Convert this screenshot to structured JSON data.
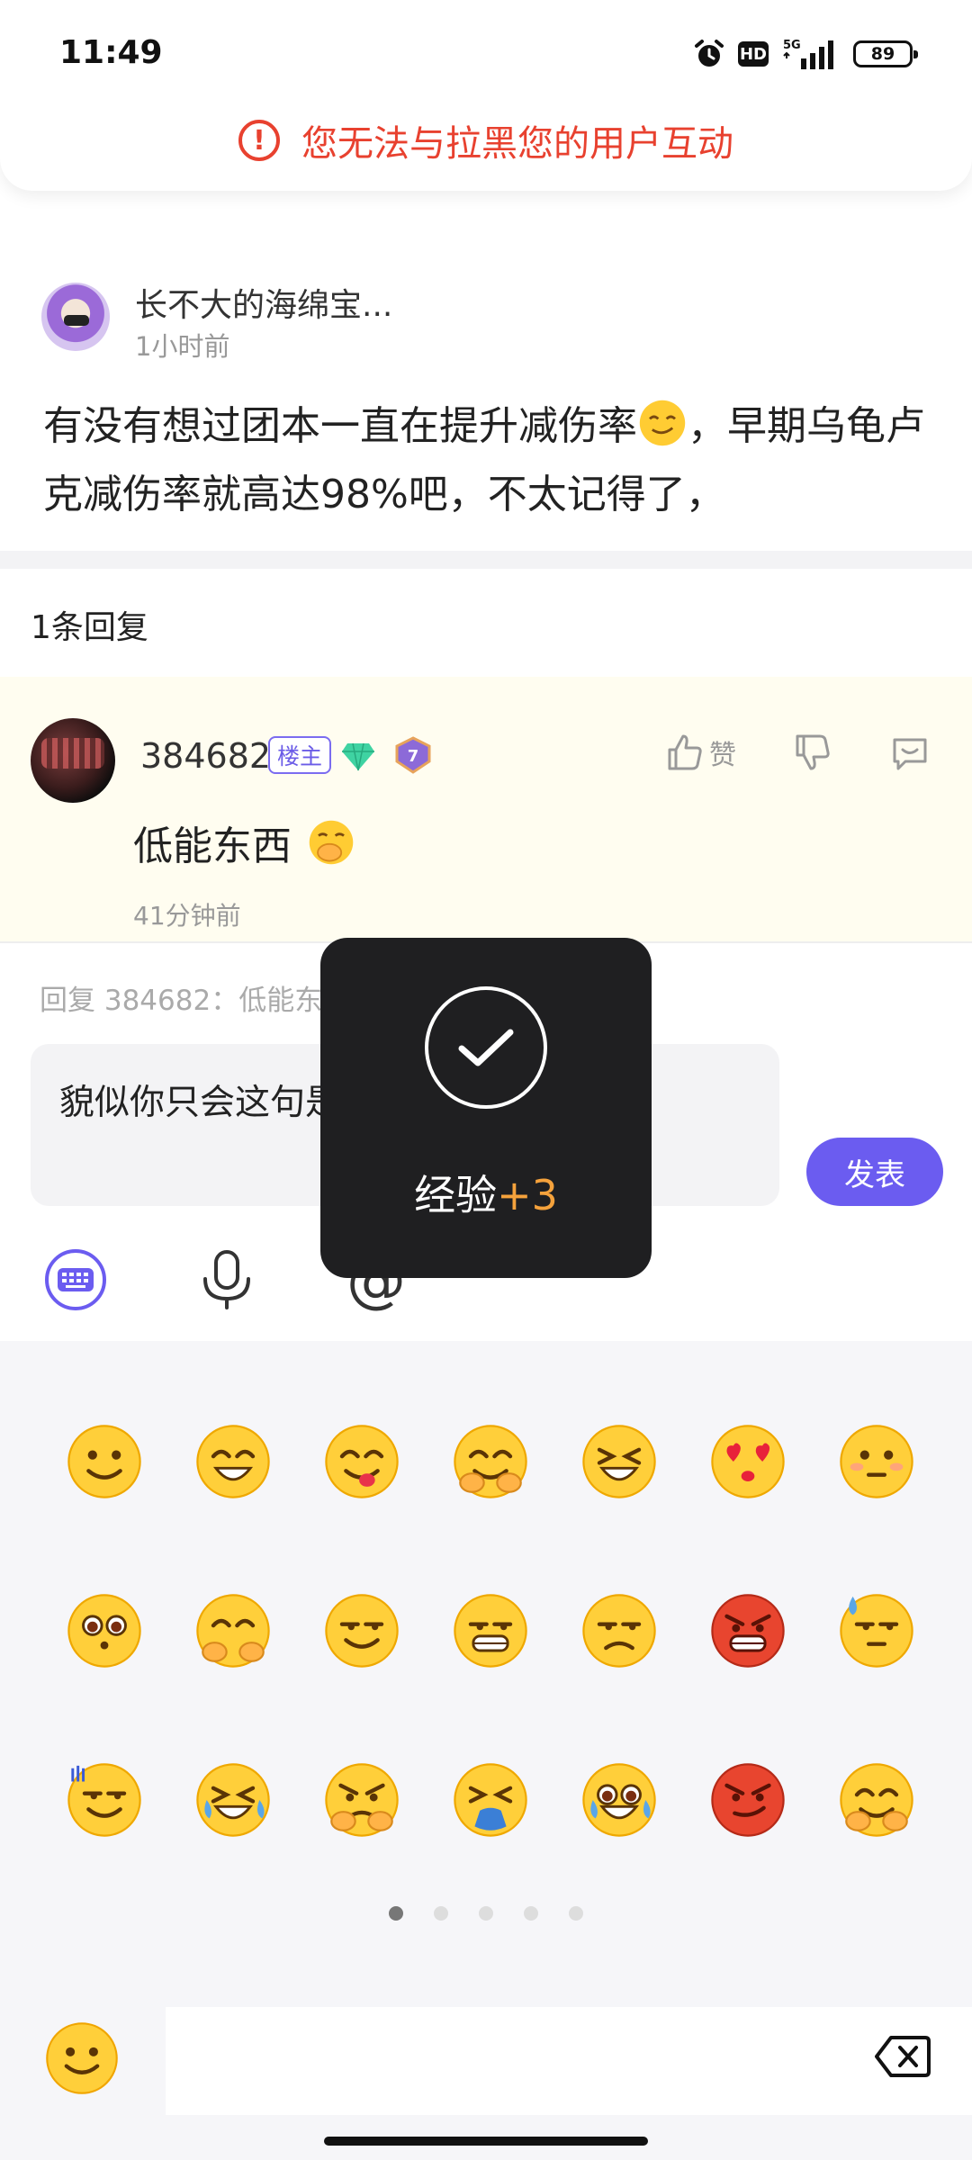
{
  "status_bar": {
    "time": "11:49",
    "hd": "HD",
    "network": "5G",
    "battery": "89"
  },
  "banner": {
    "icon": "alert-circle-icon",
    "text": "您无法与拉黑您的用户互动",
    "color": "#e8412f"
  },
  "post": {
    "username": "长不大的海绵宝...",
    "time": "1小时前",
    "text_part1": "有没有想过团本一直在提升减伤率",
    "text_part2": "，早期乌龟卢克减伤率就高达98%吧，不太记得了，"
  },
  "replies": {
    "count_label": "1条回复"
  },
  "comment": {
    "username": "384682",
    "badge": "楼主",
    "level": "7",
    "like_label": "赞",
    "text": "低能东西",
    "time": "41分钟前"
  },
  "reply_box": {
    "hint": "回复 384682：低能东西#(捂嘴笑)",
    "value": "貌似你只会这句是吗",
    "send_label": "发表"
  },
  "toast": {
    "label": "经验",
    "amount": "+3",
    "accent": "#f5a23c"
  },
  "emoji_panel": {
    "emojis": [
      "smile",
      "laugh",
      "tongue",
      "cover-face",
      "squint-laugh",
      "heart-eyes",
      "shy",
      "pleading",
      "hand-over-mouth",
      "smug",
      "grin",
      "unamused",
      "angry",
      "sweat",
      "awkward",
      "crying",
      "pointing",
      "vomit",
      "shocked",
      "red-angry",
      "hug"
    ],
    "pages": 5,
    "active_page": 1
  },
  "colors": {
    "accent": "#6b5cf0",
    "comment_bg": "#fffdf0",
    "panel_bg": "#f6f6f9"
  }
}
